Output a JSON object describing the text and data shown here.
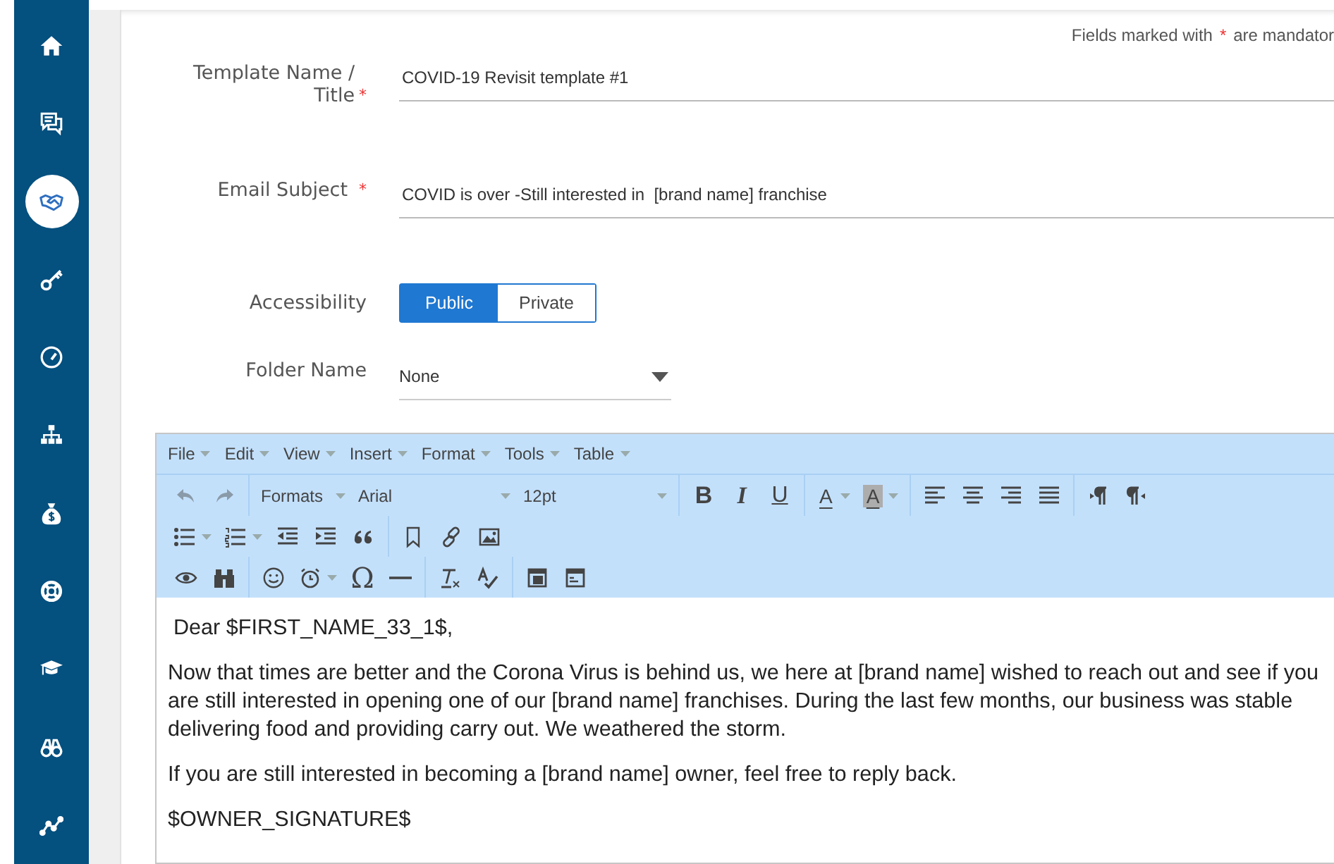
{
  "sidebar": {
    "items": [
      {
        "selected": false
      },
      {
        "selected": false
      },
      {
        "selected": true
      },
      {
        "selected": false
      },
      {
        "selected": false
      },
      {
        "selected": false
      },
      {
        "selected": false
      },
      {
        "selected": false
      },
      {
        "selected": false
      },
      {
        "selected": false
      },
      {
        "selected": false
      }
    ]
  },
  "mandatory_note": {
    "before": "Fields marked with",
    "star": "*",
    "after": "are mandator"
  },
  "form": {
    "template_name": {
      "label": "Template Name / Title",
      "required": true,
      "value": "COVID-19 Revisit template #1"
    },
    "email_subject": {
      "label": "Email Subject",
      "required": true,
      "value": "COVID is over -Still interested in  [brand name] franchise"
    },
    "accessibility": {
      "label": "Accessibility",
      "options": [
        {
          "label": "Public",
          "selected": true
        },
        {
          "label": "Private",
          "selected": false
        }
      ]
    },
    "folder_name": {
      "label": "Folder Name",
      "value": "None"
    }
  },
  "editor": {
    "menu": [
      "File",
      "Edit",
      "View",
      "Insert",
      "Format",
      "Tools",
      "Table"
    ],
    "toolbar": {
      "formats": "Formats",
      "font": "Arial",
      "size": "12pt",
      "bold": "B",
      "italic": "I",
      "underline": "U",
      "text_color": "A",
      "highlight": "A",
      "special_char": "Ω"
    },
    "body": [
      "Dear $FIRST_NAME_33_1$,",
      "Now that times are better and the Corona Virus is behind us, we here at [brand name] wished to reach out  and see if you are still interested in opening one of our [brand name] franchises. During the last few months, our business was stable delivering food and providing carry out. We weathered the storm.",
      "If you are still interested in becoming a [brand name] owner, feel free to reply back.",
      "$OWNER_SIGNATURE$"
    ]
  }
}
